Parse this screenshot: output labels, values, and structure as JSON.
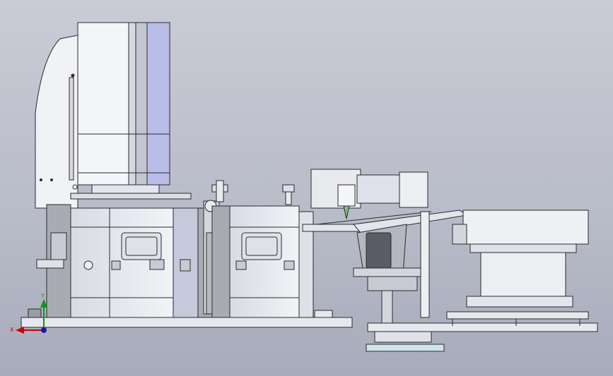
{
  "view": {
    "background_top": "#c9ccd6",
    "background_bottom": "#a8abba",
    "part_fill": "#e9eaee",
    "part_fill_dark": "#cfd1dc",
    "part_edge": "#2b2b2b",
    "accent_blue": "#b9bde8"
  },
  "triad": {
    "x_label": "X",
    "y_label": "Y",
    "x_color": "#cc0000",
    "y_color": "#0a9a0a",
    "z_color": "#1a1aa8"
  },
  "assembly": {
    "modules": [
      "press-column",
      "die-block-left",
      "die-block-right",
      "pneumatic-cylinder",
      "feeder-rail",
      "vibratory-bowl-feeder"
    ]
  }
}
